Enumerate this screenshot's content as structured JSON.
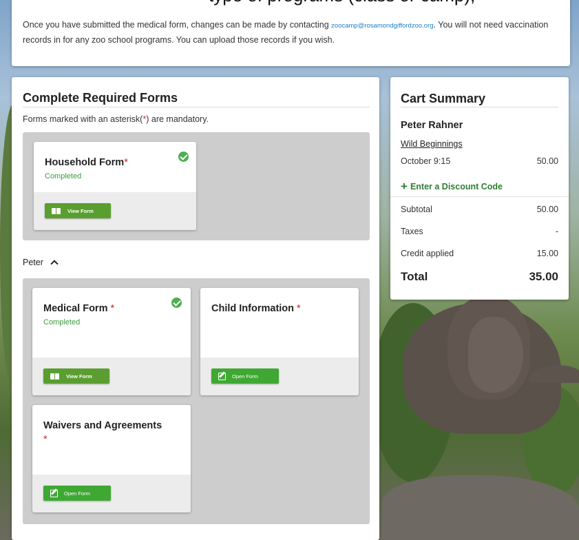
{
  "header": {
    "partial_text": "type of programs (class or camp),",
    "notice_before_email": "Once you have submitted the medical form, changes can be made by contacting ",
    "email": "zoocamp@rosamondgiffordzoo.org",
    "notice_after_email": ". You will not need vaccination records in for any zoo school programs. You can upload those records if you wish."
  },
  "forms": {
    "title": "Complete Required Forms",
    "note_before": "Forms marked with an asterisk(",
    "note_asterisk": "*",
    "note_after": ") are mandatory.",
    "person_name": "Peter",
    "household": {
      "title": "Household Form",
      "asterisk": "*",
      "status": "Completed",
      "button": "View Form"
    },
    "medical": {
      "title": "Medical Form ",
      "asterisk": "*",
      "status": "Completed",
      "button": "View Form"
    },
    "child_info": {
      "title": "Child Information ",
      "asterisk": "*",
      "button": "Open Form"
    },
    "waivers": {
      "title": "Waivers and Agreements",
      "asterisk": "*",
      "button": "Open Form"
    }
  },
  "cart": {
    "title": "Cart Summary",
    "name": "Peter Rahner",
    "program": "Wild Beginnings",
    "session": "October 9:15",
    "session_price": "50.00",
    "discount_label": "Enter a Discount Code",
    "subtotal_label": "Subtotal",
    "subtotal": "50.00",
    "taxes_label": "Taxes",
    "taxes": "-",
    "credit_label": "Credit applied",
    "credit": "15.00",
    "total_label": "Total",
    "total": "35.00"
  },
  "colors": {
    "accent_green": "#3fa833",
    "status_green": "#3c9a3c",
    "required_red": "#c62828"
  }
}
